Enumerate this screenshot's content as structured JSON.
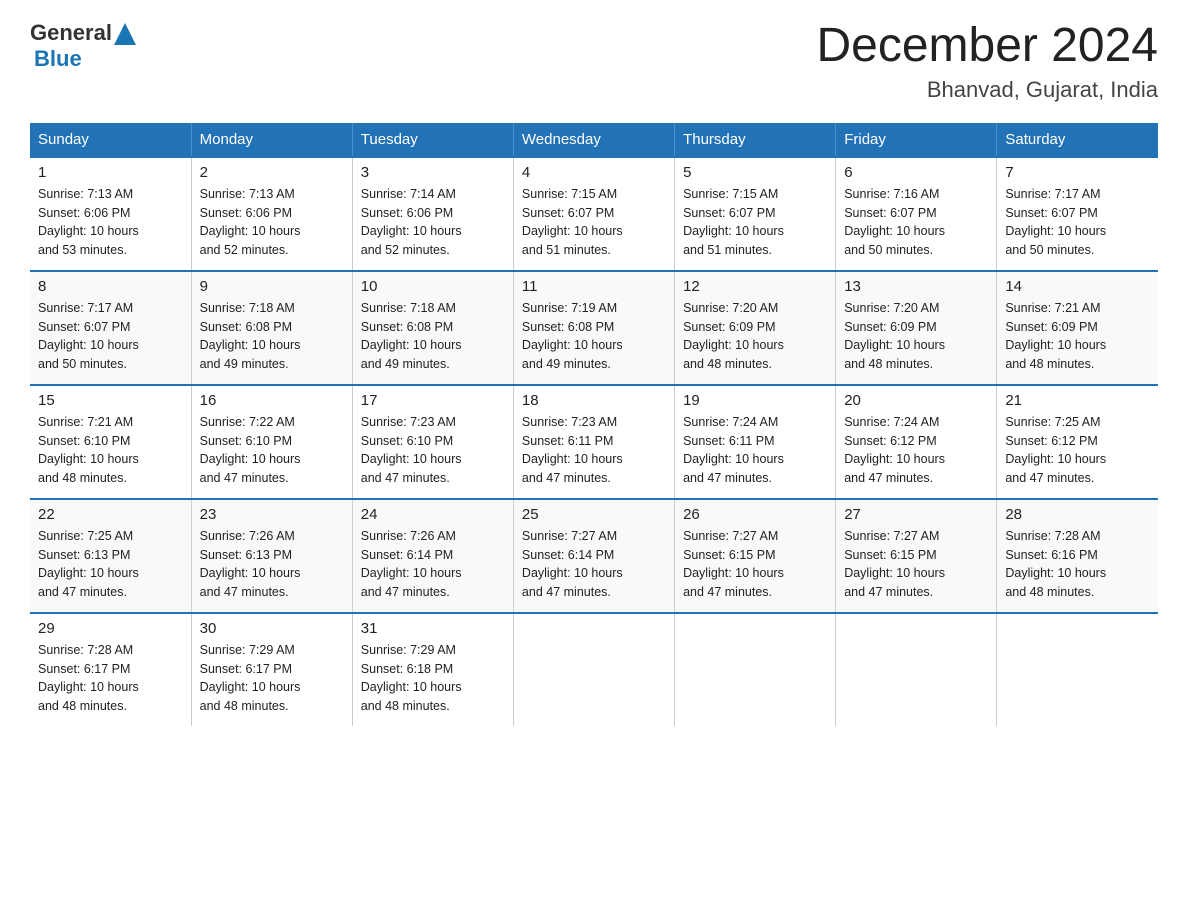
{
  "header": {
    "logo_general": "General",
    "logo_blue": "Blue",
    "month_title": "December 2024",
    "location": "Bhanvad, Gujarat, India"
  },
  "weekdays": [
    "Sunday",
    "Monday",
    "Tuesday",
    "Wednesday",
    "Thursday",
    "Friday",
    "Saturday"
  ],
  "weeks": [
    [
      {
        "day": "1",
        "sunrise": "7:13 AM",
        "sunset": "6:06 PM",
        "daylight": "10 hours and 53 minutes."
      },
      {
        "day": "2",
        "sunrise": "7:13 AM",
        "sunset": "6:06 PM",
        "daylight": "10 hours and 52 minutes."
      },
      {
        "day": "3",
        "sunrise": "7:14 AM",
        "sunset": "6:06 PM",
        "daylight": "10 hours and 52 minutes."
      },
      {
        "day": "4",
        "sunrise": "7:15 AM",
        "sunset": "6:07 PM",
        "daylight": "10 hours and 51 minutes."
      },
      {
        "day": "5",
        "sunrise": "7:15 AM",
        "sunset": "6:07 PM",
        "daylight": "10 hours and 51 minutes."
      },
      {
        "day": "6",
        "sunrise": "7:16 AM",
        "sunset": "6:07 PM",
        "daylight": "10 hours and 50 minutes."
      },
      {
        "day": "7",
        "sunrise": "7:17 AM",
        "sunset": "6:07 PM",
        "daylight": "10 hours and 50 minutes."
      }
    ],
    [
      {
        "day": "8",
        "sunrise": "7:17 AM",
        "sunset": "6:07 PM",
        "daylight": "10 hours and 50 minutes."
      },
      {
        "day": "9",
        "sunrise": "7:18 AM",
        "sunset": "6:08 PM",
        "daylight": "10 hours and 49 minutes."
      },
      {
        "day": "10",
        "sunrise": "7:18 AM",
        "sunset": "6:08 PM",
        "daylight": "10 hours and 49 minutes."
      },
      {
        "day": "11",
        "sunrise": "7:19 AM",
        "sunset": "6:08 PM",
        "daylight": "10 hours and 49 minutes."
      },
      {
        "day": "12",
        "sunrise": "7:20 AM",
        "sunset": "6:09 PM",
        "daylight": "10 hours and 48 minutes."
      },
      {
        "day": "13",
        "sunrise": "7:20 AM",
        "sunset": "6:09 PM",
        "daylight": "10 hours and 48 minutes."
      },
      {
        "day": "14",
        "sunrise": "7:21 AM",
        "sunset": "6:09 PM",
        "daylight": "10 hours and 48 minutes."
      }
    ],
    [
      {
        "day": "15",
        "sunrise": "7:21 AM",
        "sunset": "6:10 PM",
        "daylight": "10 hours and 48 minutes."
      },
      {
        "day": "16",
        "sunrise": "7:22 AM",
        "sunset": "6:10 PM",
        "daylight": "10 hours and 47 minutes."
      },
      {
        "day": "17",
        "sunrise": "7:23 AM",
        "sunset": "6:10 PM",
        "daylight": "10 hours and 47 minutes."
      },
      {
        "day": "18",
        "sunrise": "7:23 AM",
        "sunset": "6:11 PM",
        "daylight": "10 hours and 47 minutes."
      },
      {
        "day": "19",
        "sunrise": "7:24 AM",
        "sunset": "6:11 PM",
        "daylight": "10 hours and 47 minutes."
      },
      {
        "day": "20",
        "sunrise": "7:24 AM",
        "sunset": "6:12 PM",
        "daylight": "10 hours and 47 minutes."
      },
      {
        "day": "21",
        "sunrise": "7:25 AM",
        "sunset": "6:12 PM",
        "daylight": "10 hours and 47 minutes."
      }
    ],
    [
      {
        "day": "22",
        "sunrise": "7:25 AM",
        "sunset": "6:13 PM",
        "daylight": "10 hours and 47 minutes."
      },
      {
        "day": "23",
        "sunrise": "7:26 AM",
        "sunset": "6:13 PM",
        "daylight": "10 hours and 47 minutes."
      },
      {
        "day": "24",
        "sunrise": "7:26 AM",
        "sunset": "6:14 PM",
        "daylight": "10 hours and 47 minutes."
      },
      {
        "day": "25",
        "sunrise": "7:27 AM",
        "sunset": "6:14 PM",
        "daylight": "10 hours and 47 minutes."
      },
      {
        "day": "26",
        "sunrise": "7:27 AM",
        "sunset": "6:15 PM",
        "daylight": "10 hours and 47 minutes."
      },
      {
        "day": "27",
        "sunrise": "7:27 AM",
        "sunset": "6:15 PM",
        "daylight": "10 hours and 47 minutes."
      },
      {
        "day": "28",
        "sunrise": "7:28 AM",
        "sunset": "6:16 PM",
        "daylight": "10 hours and 48 minutes."
      }
    ],
    [
      {
        "day": "29",
        "sunrise": "7:28 AM",
        "sunset": "6:17 PM",
        "daylight": "10 hours and 48 minutes."
      },
      {
        "day": "30",
        "sunrise": "7:29 AM",
        "sunset": "6:17 PM",
        "daylight": "10 hours and 48 minutes."
      },
      {
        "day": "31",
        "sunrise": "7:29 AM",
        "sunset": "6:18 PM",
        "daylight": "10 hours and 48 minutes."
      },
      null,
      null,
      null,
      null
    ]
  ],
  "labels": {
    "sunrise": "Sunrise:",
    "sunset": "Sunset:",
    "daylight": "Daylight:"
  }
}
